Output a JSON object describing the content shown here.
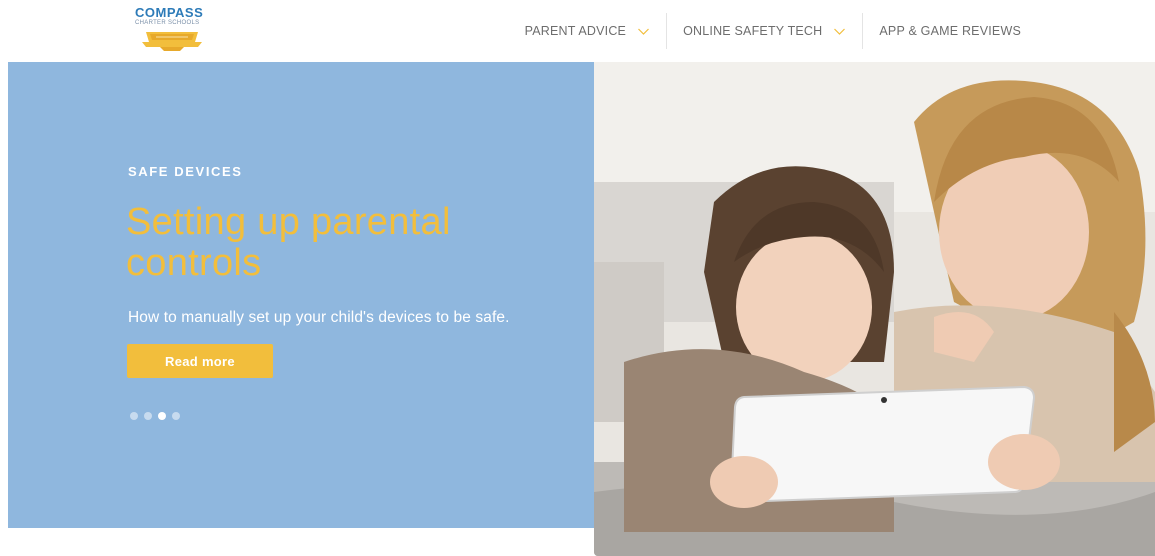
{
  "brand": {
    "name": "COMPASS",
    "tagline": "CHARTER SCHOOLS"
  },
  "nav": {
    "items": [
      {
        "label": "PARENT ADVICE",
        "has_dropdown": true
      },
      {
        "label": "ONLINE SAFETY TECH",
        "has_dropdown": true
      },
      {
        "label": "APP & GAME REVIEWS",
        "has_dropdown": false
      }
    ]
  },
  "hero": {
    "kicker": "SAFE DEVICES",
    "title": "Setting up parental controls",
    "subtitle": "How to manually set up your child's devices to be safe.",
    "cta_label": "Read more",
    "slide_count": 4,
    "active_slide": 3
  },
  "colors": {
    "panel": "#8fb7de",
    "accent": "#f2be3c",
    "nav_text": "#6d6d6d",
    "brand_blue": "#2d7bb8"
  }
}
